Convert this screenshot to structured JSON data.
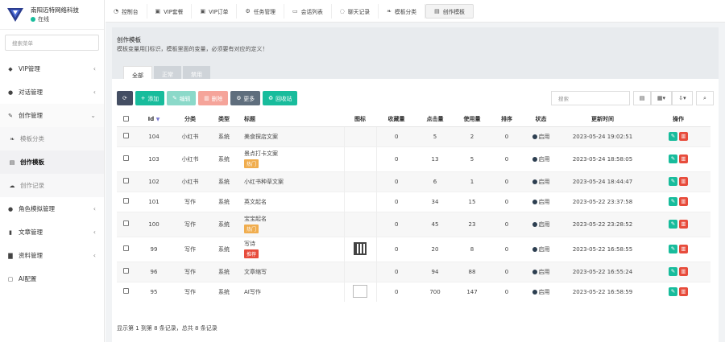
{
  "brand": {
    "name": "南阳迈特网络科技",
    "status": "在线",
    "logo_icon": "v-logo-icon"
  },
  "sidebar": {
    "search_placeholder": "搜索菜单",
    "items": [
      {
        "label": "VIP管理",
        "icon": "diamond-icon"
      },
      {
        "label": "对话管理",
        "icon": "chat-icon"
      },
      {
        "label": "创作管理",
        "icon": "pen-icon"
      },
      {
        "label": "模板分类",
        "icon": "leaf-icon"
      },
      {
        "label": "创作模板",
        "icon": "file-icon"
      },
      {
        "label": "创作记录",
        "icon": "comment-icon"
      },
      {
        "label": "角色模拟管理",
        "icon": "user-icon"
      },
      {
        "label": "文章管理",
        "icon": "bookmark-icon"
      },
      {
        "label": "资料管理",
        "icon": "book-icon"
      },
      {
        "label": "AI配置",
        "icon": "window-icon"
      }
    ]
  },
  "topnav": {
    "tabs": [
      {
        "label": "控制台",
        "icon": "dashboard-icon"
      },
      {
        "label": "VIP套餐",
        "icon": "vip-icon"
      },
      {
        "label": "VIP订单",
        "icon": "vip-icon"
      },
      {
        "label": "任务管理",
        "icon": "gear-icon"
      },
      {
        "label": "会话列表",
        "icon": "list-icon"
      },
      {
        "label": "聊天记录",
        "icon": "chat-icon"
      },
      {
        "label": "模板分类",
        "icon": "leaf-icon"
      },
      {
        "label": "创作模板",
        "icon": "file-icon"
      }
    ]
  },
  "header": {
    "title": "创作模板",
    "desc": "模板变量用[]标识，模板里面的变量，必须要有对应的定义！"
  },
  "subtabs": [
    "全部",
    "正常",
    "禁用"
  ],
  "toolbar": {
    "add": "添加",
    "edit": "编辑",
    "delete": "删除",
    "more": "更多",
    "recycle": "回收站"
  },
  "search": {
    "placeholder": "搜索"
  },
  "table": {
    "headers": [
      "Id",
      "分类",
      "类型",
      "标题",
      "图标",
      "收藏量",
      "点击量",
      "使用量",
      "排序",
      "状态",
      "更新时间",
      "操作"
    ],
    "rows": [
      {
        "id": "104",
        "category": "小红书",
        "type": "系统",
        "title": "美食探店文案",
        "flag": "",
        "flag_color": "",
        "icon": "",
        "fav": "0",
        "clicks": "5",
        "uses": "2",
        "sort": "0",
        "status": "启用",
        "updated": "2023-05-24 19:02:51"
      },
      {
        "id": "103",
        "category": "小红书",
        "type": "系统",
        "title": "景点打卡文案",
        "flag": "热门",
        "flag_color": "#f0ad4e",
        "icon": "",
        "fav": "0",
        "clicks": "13",
        "uses": "5",
        "sort": "0",
        "status": "启用",
        "updated": "2023-05-24 18:58:05"
      },
      {
        "id": "102",
        "category": "小红书",
        "type": "系统",
        "title": "小红书种草文案",
        "flag": "",
        "flag_color": "",
        "icon": "",
        "fav": "0",
        "clicks": "6",
        "uses": "1",
        "sort": "0",
        "status": "启用",
        "updated": "2023-05-24 18:44:47"
      },
      {
        "id": "101",
        "category": "写作",
        "type": "系统",
        "title": "英文起名",
        "flag": "",
        "flag_color": "",
        "icon": "",
        "fav": "0",
        "clicks": "34",
        "uses": "15",
        "sort": "0",
        "status": "启用",
        "updated": "2023-05-22 23:37:58"
      },
      {
        "id": "100",
        "category": "写作",
        "type": "系统",
        "title": "宝宝起名",
        "flag": "热门",
        "flag_color": "#f0ad4e",
        "icon": "",
        "fav": "0",
        "clicks": "45",
        "uses": "23",
        "sort": "0",
        "status": "启用",
        "updated": "2023-05-22 23:28:52"
      },
      {
        "id": "99",
        "category": "写作",
        "type": "系统",
        "title": "写诗",
        "flag": "推荐",
        "flag_color": "#e74c3c",
        "icon": "qr",
        "fav": "0",
        "clicks": "20",
        "uses": "8",
        "sort": "0",
        "status": "启用",
        "updated": "2023-05-22 16:58:55"
      },
      {
        "id": "96",
        "category": "写作",
        "type": "系统",
        "title": "文章缩写",
        "flag": "",
        "flag_color": "",
        "icon": "",
        "fav": "0",
        "clicks": "94",
        "uses": "88",
        "sort": "0",
        "status": "启用",
        "updated": "2023-05-22 16:55:24"
      },
      {
        "id": "95",
        "category": "写作",
        "type": "系统",
        "title": "AI写作",
        "flag": "",
        "flag_color": "",
        "icon": "img",
        "fav": "0",
        "clicks": "700",
        "uses": "147",
        "sort": "0",
        "status": "启用",
        "updated": "2023-05-22 16:58:59"
      }
    ]
  },
  "footer": {
    "summary": "显示第 1 到第 8 条记录，总共 8 条记录"
  }
}
